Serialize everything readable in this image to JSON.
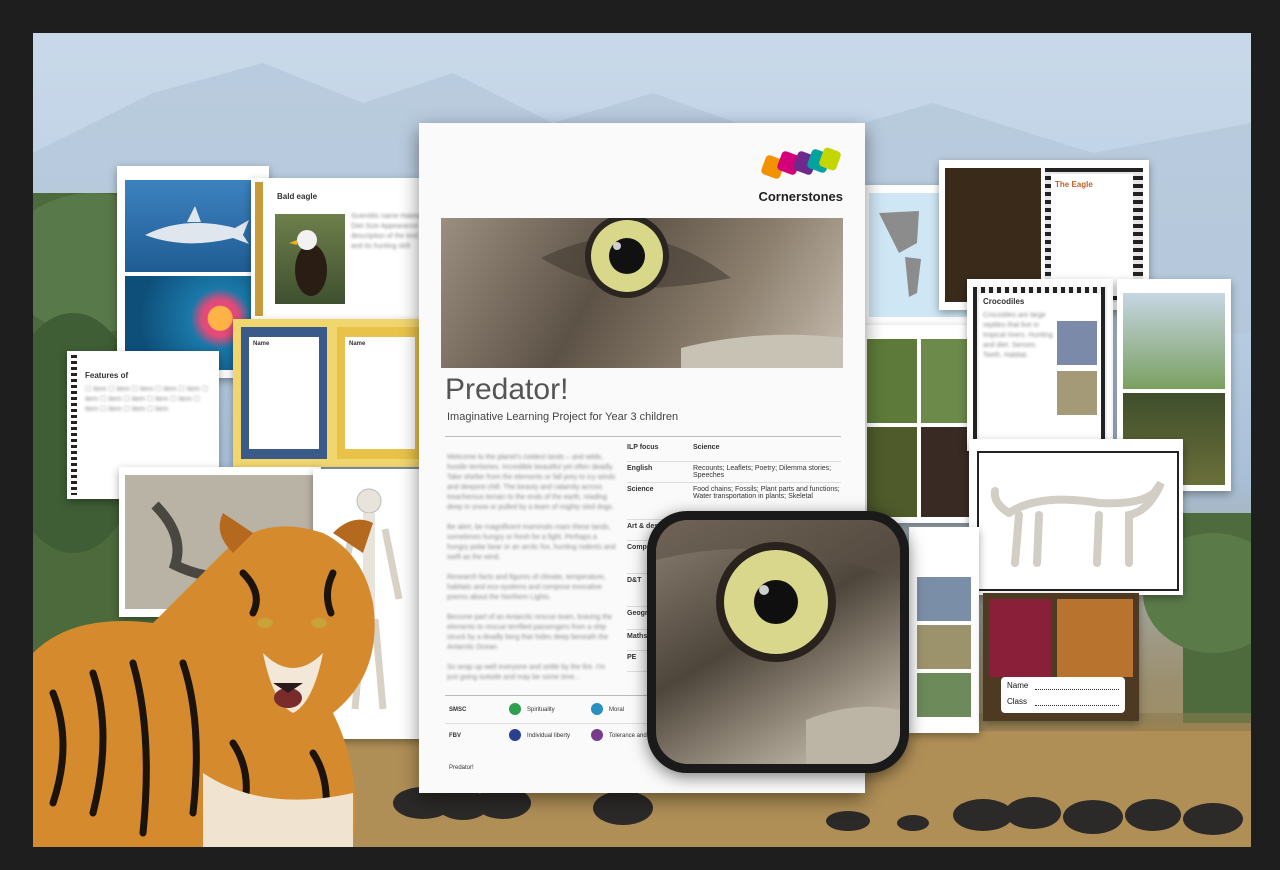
{
  "booklet": {
    "brand": "Cornerstones",
    "title": "Predator!",
    "subtitle": "Imaginative Learning Project for Year 3 children",
    "footer": "Predator!",
    "table": [
      {
        "k": "ILP focus",
        "v": "Science"
      },
      {
        "k": "English",
        "v": "Recounts; Leaflets; Poetry; Dilemma stories; Speeches"
      },
      {
        "k": "Science",
        "v": "Food chains; Fossils; Plant parts and functions; Water transportation in plants; Skeletal"
      },
      {
        "k": "Art & design",
        "v": ""
      },
      {
        "k": "Comput",
        "v": ""
      },
      {
        "k": "D&T",
        "v": ""
      },
      {
        "k": "Geogr",
        "v": ""
      },
      {
        "k": "Maths",
        "v": ""
      },
      {
        "k": "PE",
        "v": ""
      }
    ],
    "smsc_label": "SMSC",
    "smsc_items": [
      "Spirituality",
      "Moral"
    ],
    "fbv_label": "FBV",
    "fbv_items": [
      "Individual liberty",
      "Tolerance and"
    ]
  },
  "cards": {
    "bald_eagle": "Bald eagle",
    "features": "Features of",
    "name_label": "Name",
    "the_eagle": "The Eagle",
    "crocodiles": "Crocodiles",
    "name_field": "Name",
    "class_field": "Class"
  },
  "colors": {
    "logo_orange": "#f39200",
    "logo_pink": "#d4007a",
    "logo_purple": "#6d2a8c",
    "logo_teal": "#00a3a0",
    "logo_lime": "#c4d600",
    "tag_green": "#2e9e4f"
  }
}
